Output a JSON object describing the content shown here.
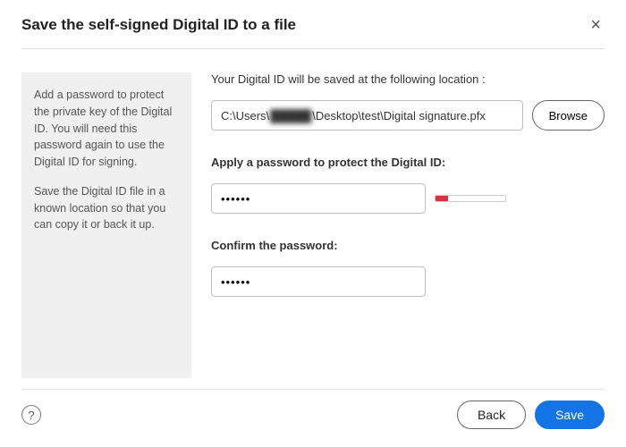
{
  "header": {
    "title": "Save the self-signed Digital ID to a file",
    "close_label": "×"
  },
  "sidebar": {
    "para1": "Add a password to protect the private key of the Digital ID. You will need this password again to use the Digital ID for signing.",
    "para2": "Save the Digital ID file in a known location so that you can copy it or back it up."
  },
  "main": {
    "location_label": "Your Digital ID will be saved at the following location :",
    "path_prefix": "C:\\Users\\",
    "path_redacted": "█████",
    "path_suffix": "\\Desktop\\test\\Digital signature.pfx",
    "browse_label": "Browse",
    "password_label": "Apply a password to protect the Digital ID:",
    "password_value": "••••••",
    "strength_percent": 18,
    "strength_color": "#d9343e",
    "confirm_label": "Confirm the password:",
    "confirm_value": "••••••"
  },
  "footer": {
    "help_label": "?",
    "back_label": "Back",
    "save_label": "Save"
  }
}
